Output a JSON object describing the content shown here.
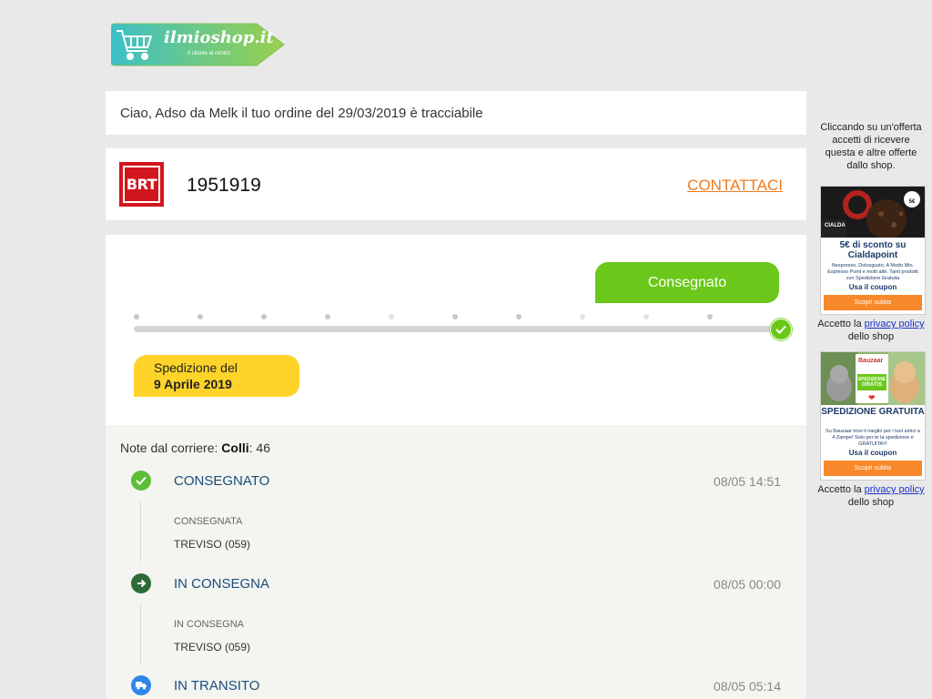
{
  "brand": {
    "logo_text": "ilmioshop.it",
    "tagline": "Il cliente al centro"
  },
  "greeting": "Ciao, Adso da Melk il tuo ordine del 29/03/2019 è tracciabile",
  "courier": {
    "logo_text": "BRT",
    "tracking_number": "1951919",
    "contact_label": "CONTATTACI"
  },
  "status": {
    "current_label": "Consegnato",
    "progress": 1.0,
    "shipment_line1": "Spedizione del",
    "shipment_line2": "9 Aprile 2019"
  },
  "notes": {
    "prefix": "Note dal corriere: ",
    "colli_label": "Colli",
    "colli_value": ": 46"
  },
  "events": [
    {
      "title": "CONSEGNATO",
      "time": "08/05 14:51",
      "detail": "CONSEGNATA",
      "location": "TREVISO (059)",
      "icon": "check-icon",
      "color": "#5cbf3a"
    },
    {
      "title": "IN CONSEGNA",
      "time": "08/05 00:00",
      "detail": "IN CONSEGNA",
      "location": "TREVISO (059)",
      "icon": "arrow-right-icon",
      "color": "#2e6b3a"
    },
    {
      "title": "IN TRANSITO",
      "time": "08/05 05:14",
      "icon": "truck-icon",
      "color": "#2f86e8"
    }
  ],
  "sidebar": {
    "intro": "Cliccando su un'offerta accetti di ricevere questa e altre offerte dallo shop.",
    "accept_prefix": "Accetto la ",
    "accept_link": "privacy policy",
    "accept_suffix": " dello shop",
    "ads": [
      {
        "brand": "CIALDA",
        "badge": "5€",
        "headline": "5€ di sconto su Cialdapoint",
        "body": "Nespresso, Dolcegusto, A Modo Mio, Espresso Point e molti altri. Tanti prodotti con Spedizione Gratuita",
        "cta_text": "Usa il coupon",
        "button": "Scopri subito"
      },
      {
        "brand": "Bauzaar",
        "badge_line1": "SPEDIZIONE",
        "badge_line2": "GRATIS",
        "headline": "SPEDIZIONE GRATUITA",
        "body": "Su Bauzaar trovi il meglio per i tuoi amici a 4 Zampe! Solo per te la spedizione è GRATUITA!!!",
        "cta_text": "Usa il coupon",
        "button": "Scopri subito"
      }
    ]
  },
  "colors": {
    "green": "#6bc81a",
    "yellow": "#fed42b",
    "orange": "#f07a1c",
    "brt_red": "#d2161e",
    "navy": "#1a4d7a"
  }
}
